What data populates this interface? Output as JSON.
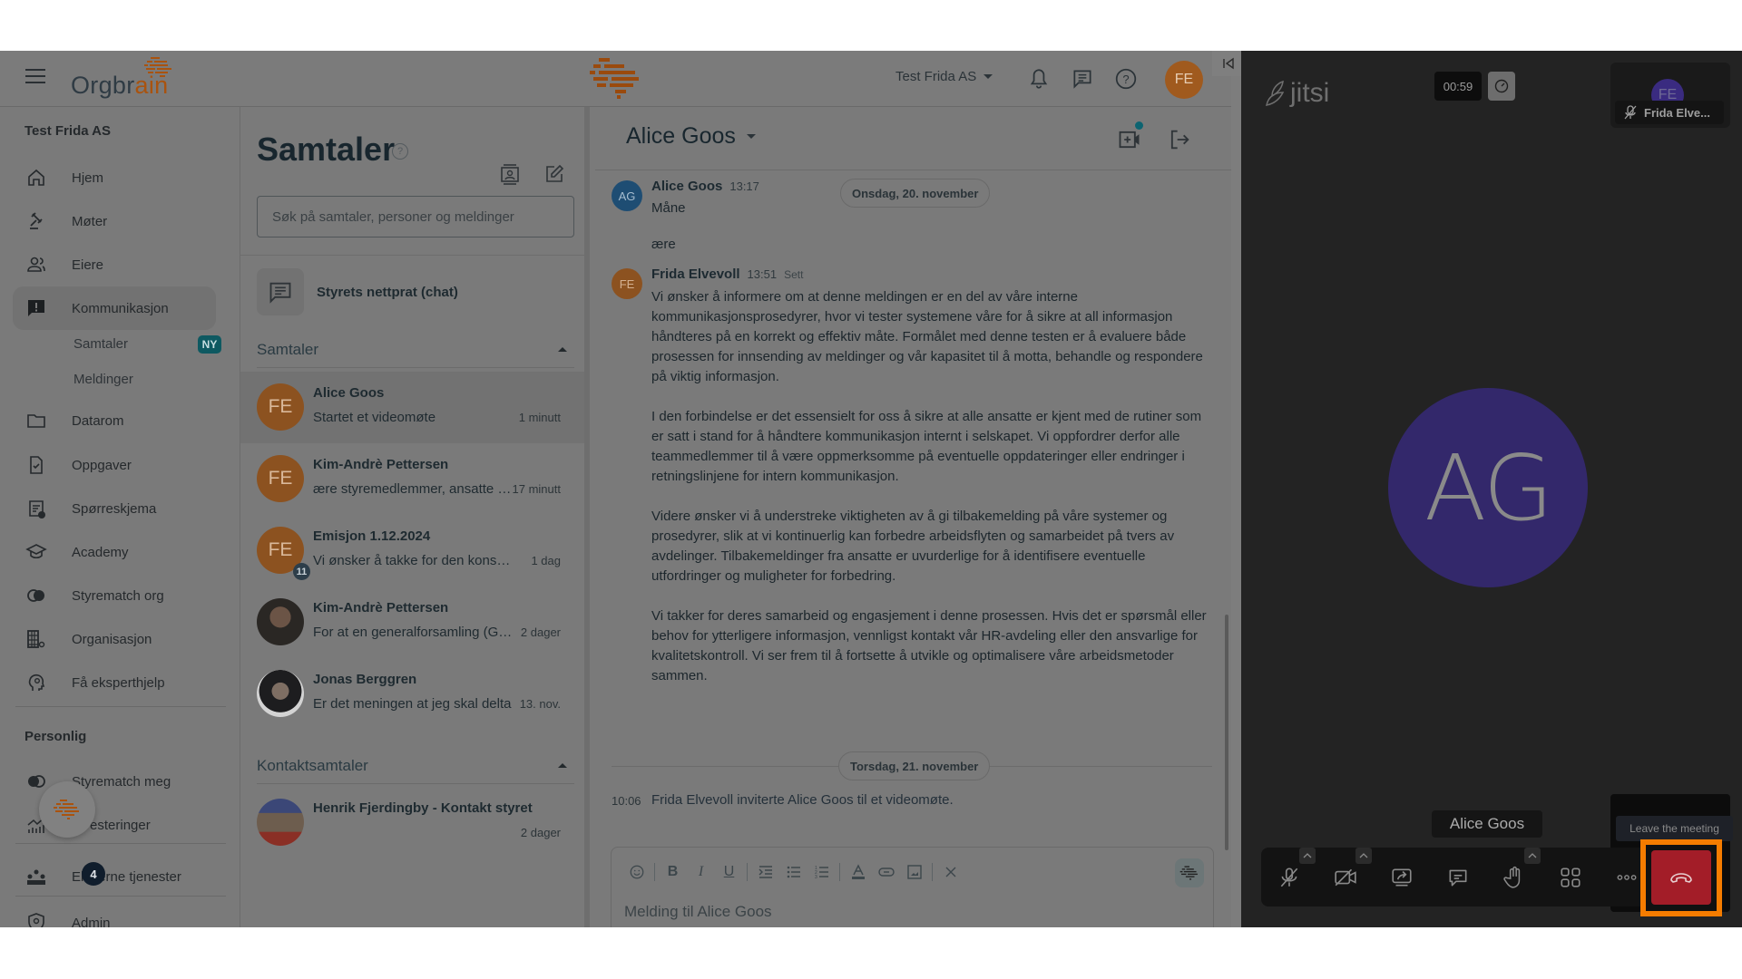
{
  "header": {
    "brand_prefix": "Orgbr",
    "brand_accent": "ain",
    "org_selector": "Test Frida AS",
    "user_initials": "FE",
    "icons": [
      "hamburger-icon",
      "bell-icon",
      "chat-icon",
      "help-icon"
    ]
  },
  "sidebar": {
    "org_name": "Test Frida AS",
    "items": [
      {
        "label": "Hjem",
        "icon": "home-icon"
      },
      {
        "label": "Møter",
        "icon": "gavel-icon"
      },
      {
        "label": "Eiere",
        "icon": "people-icon"
      },
      {
        "label": "Kommunikasjon",
        "icon": "announcement-icon",
        "active": true
      },
      {
        "label": "Datarom",
        "icon": "folder-icon"
      },
      {
        "label": "Oppgaver",
        "icon": "task-icon"
      },
      {
        "label": "Spørreskjema",
        "icon": "survey-icon"
      },
      {
        "label": "Academy",
        "icon": "school-icon"
      },
      {
        "label": "Styrematch org",
        "icon": "match-icon"
      },
      {
        "label": "Organisasjon",
        "icon": "organization-icon"
      },
      {
        "label": "Få eksperthjelp",
        "icon": "expert-icon"
      }
    ],
    "sub_items": [
      {
        "label": "Samtaler",
        "badge": "NY"
      },
      {
        "label": "Meldinger"
      }
    ],
    "personal_title": "Personlig",
    "personal_items": [
      {
        "label": "Styrematch meg",
        "icon": "match-icon"
      },
      {
        "label": "Investeringer",
        "icon": "chart-icon"
      },
      {
        "label": "Eksterne tjenester",
        "icon": "services-icon"
      },
      {
        "label": "Admin",
        "icon": "admin-icon"
      }
    ],
    "fab_badge": "4"
  },
  "conversations": {
    "title": "Samtaler",
    "search_placeholder": "Søk på samtaler, personer og meldinger",
    "chat_room": "Styrets nettprat (chat)",
    "group_label": "Samtaler",
    "items": [
      {
        "name": "Alice Goos",
        "initials": "FE",
        "preview": "Startet et videomøte",
        "time": "1 minutt",
        "selected": true
      },
      {
        "name": "Kim-Andrè Pettersen",
        "initials": "FE",
        "preview": "ære styremedlemmer, ansatte og aksjonærer",
        "time": "17 minutt"
      },
      {
        "name": "Emisjon 1.12.2024",
        "initials": "FE",
        "preview": "Vi ønsker å takke for den konstruktive",
        "time": "1 dag",
        "badge": "11"
      },
      {
        "name": "Kim-Andrè Pettersen",
        "initials": "",
        "preview": "For at en generalforsamling (GF) skal",
        "time": "2 dager"
      },
      {
        "name": "Jonas Berggren",
        "initials": "",
        "preview": "Er det meningen at jeg skal delta",
        "time": "13. nov."
      }
    ],
    "contact_group_label": "Kontaktsamtaler",
    "contact_items": [
      {
        "name": "Henrik Fjerdingby - Kontakt styret",
        "time": "2 dager"
      }
    ]
  },
  "chat": {
    "title": "Alice Goos",
    "messages": [
      {
        "author": "Alice Goos",
        "initials": "AG",
        "time": "13:17",
        "lines": [
          "Måne",
          "ære"
        ]
      },
      {
        "author": "Frida Elvevoll",
        "initials": "FE",
        "time": "13:51",
        "status": "Sett",
        "paragraphs": [
          "Vi ønsker å informere om at denne meldingen er en del av våre interne kommunikasjonsprosedyrer, hvor vi tester systemene våre for å sikre at all informasjon håndteres på en korrekt og effektiv måte. Formålet med denne testen er å evaluere både prosessen for innsending av meldinger og vår kapasitet til å motta, behandle og respondere på viktig informasjon.",
          "I den forbindelse er det essensielt for oss å sikre at alle ansatte er kjent med de rutiner som er satt i stand for å håndtere kommunikasjon internt i selskapet. Vi oppfordrer derfor alle teammedlemmer til å være oppmerksomme på eventuelle oppdateringer eller endringer i retningslinjene for intern kommunikasjon.",
          "Videre ønsker vi å understreke viktigheten av å gi tilbakemelding på våre systemer og prosedyrer, slik at vi kontinuerlig kan forbedre arbeidsflyten og samarbeidet på tvers av avdelinger. Tilbakemeldinger fra ansatte er uvurderlige for å identifisere eventuelle utfordringer og muligheter for forbedring.",
          "Vi takker for deres samarbeid og engasjement i denne prosessen. Hvis det er spørsmål eller behov for ytterligere informasjon, vennligst kontakt vår HR-avdeling eller den ansvarlige for kvalitetskontroll. Vi ser frem til å fortsette å utvikle og optimalisere våre arbeidsmetoder sammen."
        ]
      }
    ],
    "date_pill_1": "Onsdag, 20. november",
    "date_pill_2": "Torsdag, 21. november",
    "system_event": {
      "time": "10:06",
      "text": "Frida Elvevoll inviterte Alice Goos til et videomøte."
    },
    "composer_placeholder": "Melding til Alice Goos",
    "toolbar_icons": [
      "emoji-icon",
      "bold-icon",
      "italic-icon",
      "underline-icon",
      "indent-icon",
      "bullet-list-icon",
      "numbered-list-icon",
      "text-color-icon",
      "link-icon",
      "image-icon",
      "clear-format-icon"
    ]
  },
  "jitsi": {
    "logo": "jitsi",
    "timer": "00:59",
    "thumbnail_initials": "FE",
    "thumbnail_name": "Frida Elve...",
    "main_initials": "AG",
    "main_name": "Alice Goos",
    "tooltip": "Leave the meeting",
    "toolbar": [
      "microphone-muted-icon",
      "camera-off-icon",
      "screenshare-icon",
      "chat-icon",
      "raise-hand-icon",
      "tile-view-icon",
      "more-icon",
      "hangup-icon"
    ],
    "colors": {
      "hangup": "#a31d28",
      "highlight": "#f57c00",
      "avatar": "#33286b"
    }
  }
}
